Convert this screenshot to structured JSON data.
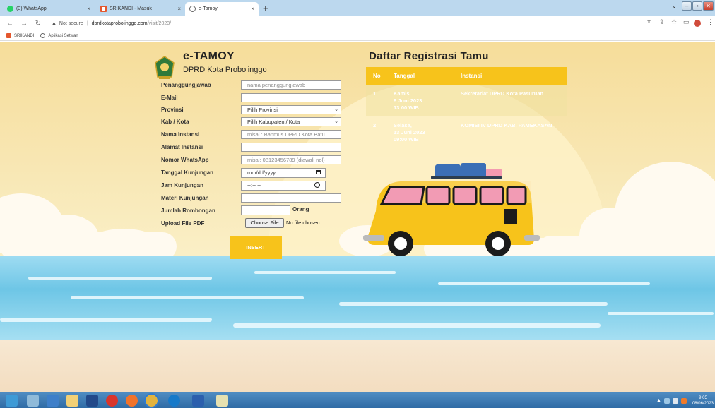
{
  "browser": {
    "tabs": [
      {
        "label": "(3) WhatsApp",
        "icon": "whatsapp-icon",
        "active": false
      },
      {
        "label": "SRIKANDI - Masuk",
        "icon": "srikandi-icon",
        "active": false
      },
      {
        "label": "e-Tamoy",
        "icon": "globe-icon",
        "active": true
      }
    ],
    "close_glyph": "×",
    "new_tab": "+",
    "address": {
      "security": "Not secure",
      "domain": "dprdkotaprobolinggo.com",
      "path": "/visit/2023/"
    },
    "bookmarks": [
      {
        "label": "SRIKANDI",
        "icon": "srikandi-icon"
      },
      {
        "label": "Aplikasi Setwan",
        "icon": "globe-icon"
      }
    ]
  },
  "app": {
    "title": "e-TAMOY",
    "subtitle": "DPRD Kota Probolinggo"
  },
  "form": {
    "fields": [
      {
        "label": "Penanggungjawab",
        "value": "",
        "placeholder": "nama penanggungjawab",
        "type": "text"
      },
      {
        "label": "E-Mail",
        "value": "",
        "placeholder": "",
        "type": "text"
      },
      {
        "label": "Provinsi",
        "value": "Pilih Provinsi",
        "placeholder": "",
        "type": "select"
      },
      {
        "label": "Kab / Kota",
        "value": "Pilih Kabupaten / Kota",
        "placeholder": "",
        "type": "select"
      },
      {
        "label": "Nama Instansi",
        "value": "",
        "placeholder": "misal : Banmus DPRD Kota Batu",
        "type": "text"
      },
      {
        "label": "Alamat Instansi",
        "value": "",
        "placeholder": "",
        "type": "text"
      },
      {
        "label": "Nomor WhatsApp",
        "value": "",
        "placeholder": "misal: 08123456789 (diawali nol)",
        "type": "text"
      },
      {
        "label": "Tanggal Kunjungan",
        "value": "mm/dd/yyyy",
        "placeholder": "",
        "type": "date"
      },
      {
        "label": "Jam Kunjungan",
        "value": "--:-- --",
        "placeholder": "",
        "type": "time"
      },
      {
        "label": "Materi Kunjungan",
        "value": "",
        "placeholder": "",
        "type": "text"
      },
      {
        "label": "Jumlah Rombongan",
        "value": "",
        "placeholder": "",
        "type": "number",
        "suffix": "Orang"
      },
      {
        "label": "Upload File PDF",
        "value": "No file chosen",
        "placeholder": "",
        "type": "file",
        "button": "Choose File"
      }
    ],
    "submit_label": "INSERT"
  },
  "registry": {
    "title": "Daftar Registrasi Tamu",
    "columns": [
      "No",
      "Tanggal",
      "Instansi"
    ],
    "rows": [
      {
        "no": "1",
        "date_line1": "Kamis,",
        "date_line2": "8 Juni 2023",
        "date_line3": "13:00 WIB",
        "instansi": "Sekretariat DPRD Kota Pasuruan"
      },
      {
        "no": "2",
        "date_line1": "Selasa,",
        "date_line2": "13 Juni 2023",
        "date_line3": "09:00 WIB",
        "instansi": "KOMISI IV DPRD KAB. PAMEKASAN"
      }
    ]
  },
  "taskbar": {
    "clock_time": "9:05",
    "clock_date": "08/06/2023"
  },
  "colors": {
    "accent": "#f7c31b",
    "sky": "#f6dd9a",
    "sea": "#6ec6e6",
    "van_body": "#f7c31b"
  }
}
